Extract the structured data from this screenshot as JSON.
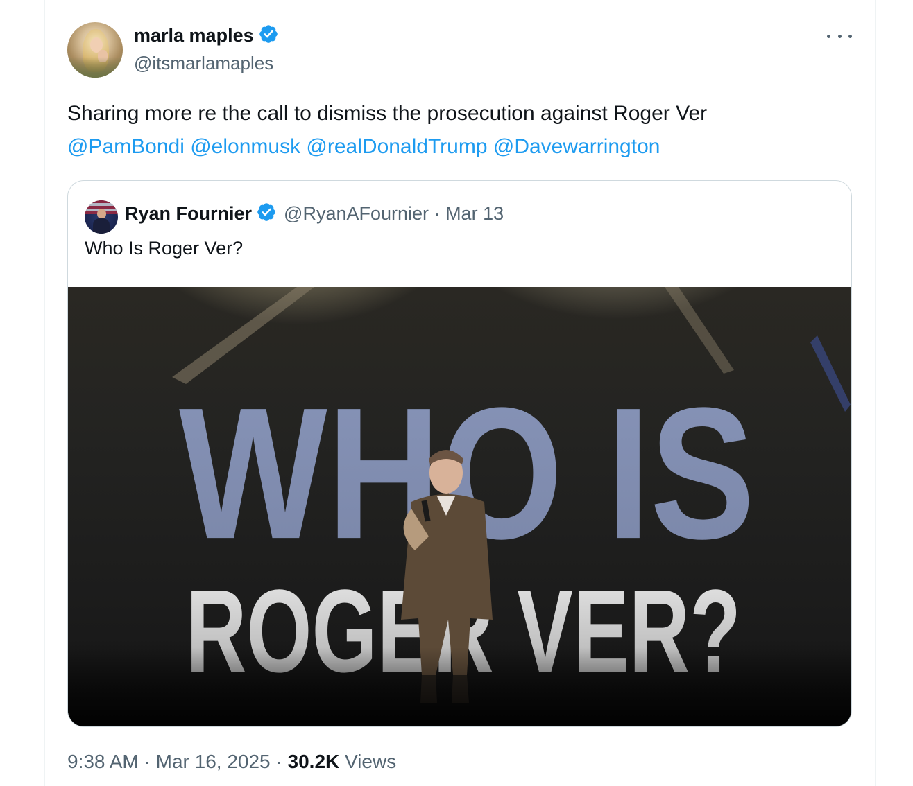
{
  "tweet": {
    "author": {
      "name": "marla maples",
      "handle": "@itsmarlamaples",
      "verified": true
    },
    "text_main": "Sharing more re the call to dismiss the prosecution against Roger Ver",
    "mentions": [
      "@PamBondi",
      "@elonmusk",
      "@realDonaldTrump",
      "@Davewarrington"
    ],
    "time": "9:38 AM",
    "date": "Mar 16, 2025",
    "views_count": "30.2K",
    "views_label": "Views",
    "separator": "·"
  },
  "quote": {
    "author": {
      "name": "Ryan Fournier",
      "handle": "@RyanAFournier",
      "date": "Mar 13",
      "verified": true
    },
    "text": "Who Is Roger Ver?",
    "media": {
      "line1": "WHO IS",
      "line2": "ROGER VER?"
    }
  },
  "colors": {
    "link": "#1d9bf0",
    "verified": "#1d9bf0",
    "secondary_text": "#536471",
    "primary_text": "#0f1419",
    "border": "#cfd9de"
  },
  "icons": {
    "verified": "verified-badge-icon",
    "more": "more-options-icon"
  }
}
